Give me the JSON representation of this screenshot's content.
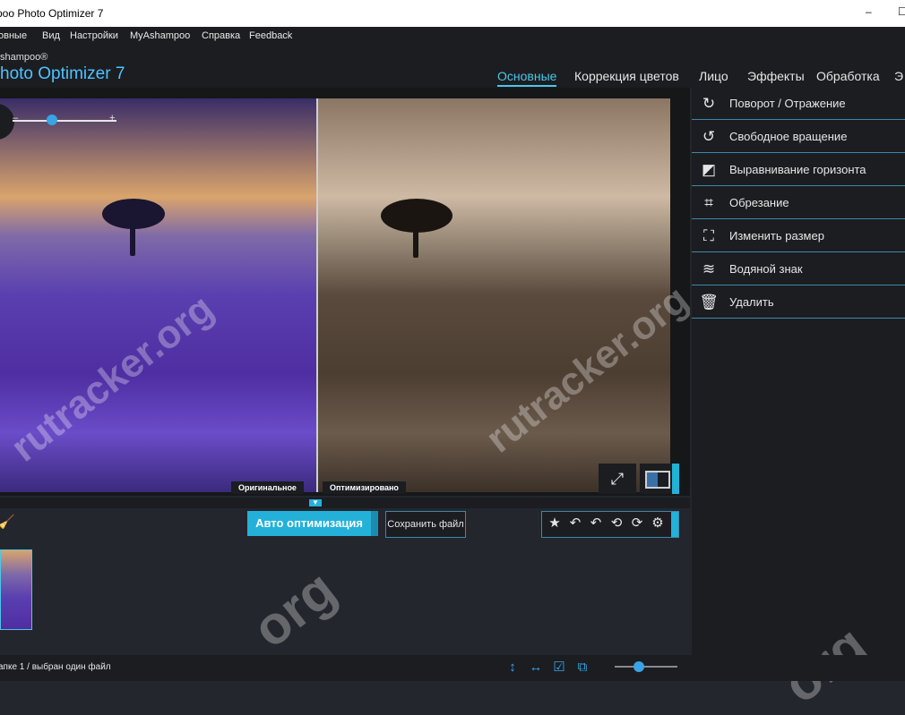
{
  "window": {
    "title": "poo Photo Optimizer 7",
    "minimize": "–",
    "maximize": "☐"
  },
  "menu": [
    "овные",
    "Вид",
    "Настройки",
    "MyAshampoo",
    "Справка",
    "Feedback"
  ],
  "brand": {
    "small": "shampoo®",
    "big": "hoto Optimizer 7"
  },
  "tabs": [
    {
      "label": "Основные",
      "active": true
    },
    {
      "label": "Коррекция цветов"
    },
    {
      "label": "Лицо"
    },
    {
      "label": "Эффекты"
    },
    {
      "label": "Обработка"
    },
    {
      "label": "Э"
    }
  ],
  "canvas": {
    "zoom_minus": "–",
    "zoom_plus": "+",
    "labels": {
      "original": "Оригинальное",
      "optimized": "Оптимизировано"
    },
    "watermarks": [
      "rutracker.org",
      "rutracker.org",
      "org",
      "org"
    ]
  },
  "panel": {
    "items": [
      {
        "label": "Поворот / Отражение",
        "icon": "rotate-icon"
      },
      {
        "label": "Свободное вращение",
        "icon": "free-rotate-icon"
      },
      {
        "label": "Выравнивание горизонта",
        "icon": "horizon-icon"
      },
      {
        "label": "Обрезание",
        "icon": "crop-icon"
      },
      {
        "label": "Изменить размер",
        "icon": "resize-icon"
      },
      {
        "label": "Водяной знак",
        "icon": "watermark-icon"
      },
      {
        "label": "Удалить",
        "icon": "trash-icon"
      }
    ]
  },
  "toolbar": {
    "auto_label": "Авто оптимизация",
    "save_label": "Сохранить файл",
    "tools": [
      "★",
      "↶",
      "↶",
      "⟲",
      "⟳",
      "⚙"
    ],
    "tool_names": [
      "favorite-icon",
      "undo-icon",
      "undo-all-icon",
      "rotate-left-90-icon",
      "rotate-right-90-icon",
      "settings-icon"
    ]
  },
  "status": {
    "text": "апке 1 / выбран один файл"
  },
  "colors": {
    "accent": "#23b1da",
    "bg": "#1b1d21",
    "tab_active": "#4cc7e6"
  }
}
